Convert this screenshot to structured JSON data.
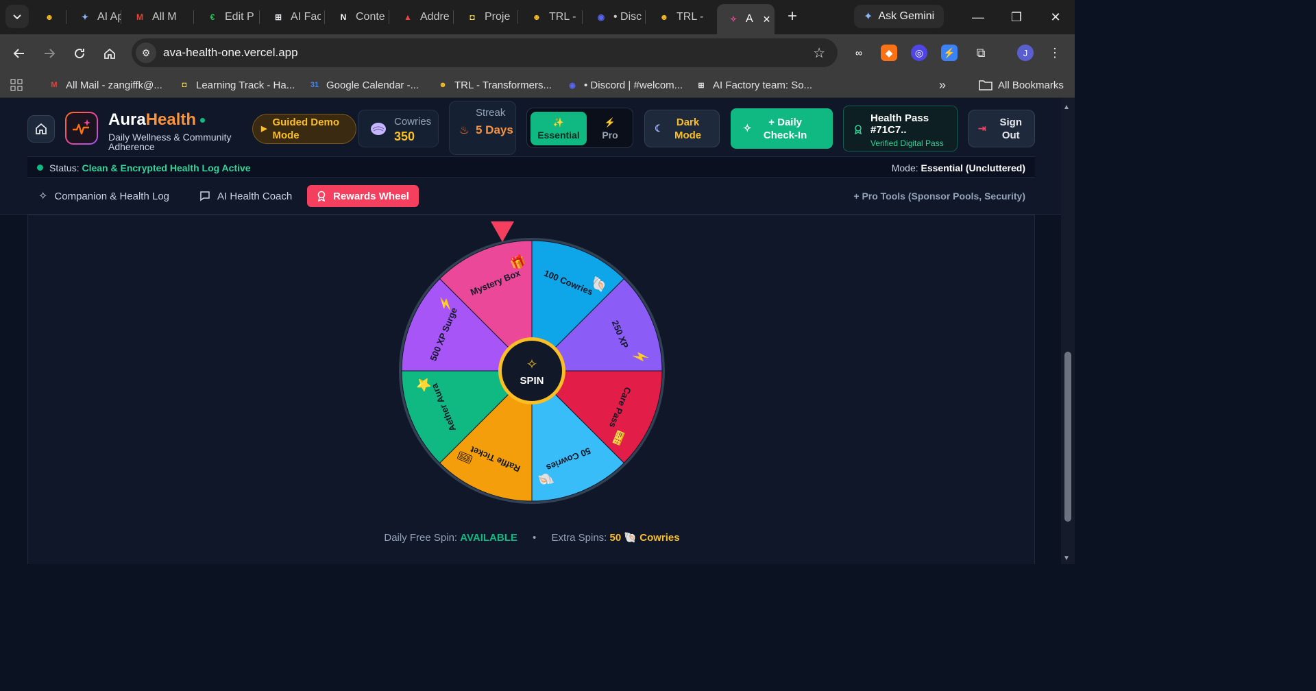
{
  "browser": {
    "tabs": [
      {
        "label": "",
        "icon": "hugging-face-icon",
        "color": "#fbbf24"
      },
      {
        "label": "AI Ap",
        "icon": "gemini-icon",
        "color": "#8ab4f8"
      },
      {
        "label": "All M",
        "icon": "gmail-icon",
        "color": "#ea4335"
      },
      {
        "label": "Edit P",
        "icon": "edit-icon",
        "color": "#22c55e"
      },
      {
        "label": "AI Fac",
        "icon": "lab-icon",
        "color": "#e5e7eb"
      },
      {
        "label": "Conte",
        "icon": "notion-icon",
        "color": "#ffffff"
      },
      {
        "label": "Addre",
        "icon": "address-icon",
        "color": "#ef4444"
      },
      {
        "label": "Proje",
        "icon": "project-icon",
        "color": "#fde047"
      },
      {
        "label": "TRL -",
        "icon": "hugging-face-icon",
        "color": "#fbbf24"
      },
      {
        "label": "• Disc",
        "icon": "discord-icon",
        "color": "#5865f2"
      },
      {
        "label": "TRL -",
        "icon": "hugging-face-icon",
        "color": "#fbbf24"
      },
      {
        "label": "A",
        "icon": "aurahealth-icon",
        "color": "#ec4899"
      }
    ],
    "ask_gemini": "Ask Gemini",
    "url": "ava-health-one.vercel.app",
    "bookmarks": [
      {
        "label": "All Mail - zangiffk@...",
        "icon": "gmail-icon",
        "color": "#ea4335"
      },
      {
        "label": "Learning Track - Ha...",
        "icon": "project-icon",
        "color": "#fde047"
      },
      {
        "label": "Google Calendar -...",
        "icon": "calendar-icon",
        "color": "#4285f4"
      },
      {
        "label": "TRL - Transformers...",
        "icon": "hugging-face-icon",
        "color": "#fbbf24"
      },
      {
        "label": "• Discord | #welcom...",
        "icon": "discord-icon",
        "color": "#5865f2"
      },
      {
        "label": "AI Factory team: So...",
        "icon": "lab-icon",
        "color": "#e5e7eb"
      }
    ],
    "all_bookmarks": "All Bookmarks",
    "profile_initial": "J"
  },
  "header": {
    "brand_part1": "Aura",
    "brand_part2": "Health",
    "tagline": "Daily Wellness & Community Adherence",
    "demo_label": "Guided Demo Mode",
    "cowries_label": "Cowries",
    "cowries_value": "350",
    "streak_label": "Streak",
    "streak_value": "5 Days",
    "mode_essential": "Essential",
    "mode_pro": "Pro",
    "dark_mode": "Dark Mode",
    "checkin": "+ Daily Check-In",
    "pass_title": "Health Pass #71C7..",
    "pass_sub": "Verified Digital Pass",
    "sign_out": "Sign Out"
  },
  "status": {
    "label": "Status:",
    "value": "Clean & Encrypted Health Log Active",
    "mode_label": "Mode:",
    "mode_value": "Essential (Uncluttered)"
  },
  "nav_tabs": [
    {
      "label": "Companion & Health Log",
      "icon": "sparkles-icon",
      "active": false
    },
    {
      "label": "AI Health Coach",
      "icon": "chat-icon",
      "active": false
    },
    {
      "label": "Rewards Wheel",
      "icon": "award-icon",
      "active": true
    }
  ],
  "pro_tools": "+ Pro Tools (Sponsor Pools, Security)",
  "wheel": {
    "spin_label": "SPIN",
    "segments": [
      {
        "label": "100 Cowries",
        "color": "#0ea5e9",
        "icon": "shell-icon"
      },
      {
        "label": "250 XP",
        "color": "#8b5cf6",
        "icon": "lightning-icon"
      },
      {
        "label": "Care Pass",
        "color": "#e11d48",
        "icon": "ticket-icon"
      },
      {
        "label": "50 Cowries",
        "color": "#38bdf8",
        "icon": "shell-icon"
      },
      {
        "label": "Raffle Ticket",
        "color": "#f59e0b",
        "icon": "raffle-icon"
      },
      {
        "label": "Aether Aura",
        "color": "#10b981",
        "icon": "star-icon"
      },
      {
        "label": "500 XP Surge",
        "color": "#a855f7",
        "icon": "lightning-icon"
      },
      {
        "label": "Mystery Box",
        "color": "#ec4899",
        "icon": "gift-icon"
      }
    ]
  },
  "spin_info": {
    "daily_label": "Daily Free Spin:",
    "daily_value": "AVAILABLE",
    "extra_label": "Extra Spins:",
    "extra_value": "50",
    "extra_unit": "Cowries"
  }
}
